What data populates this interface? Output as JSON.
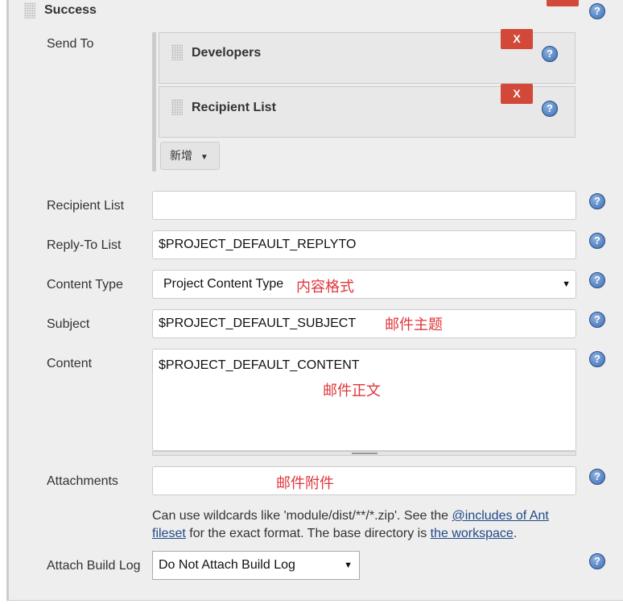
{
  "section": {
    "title": "Success"
  },
  "send_to": {
    "label": "Send To",
    "items": [
      {
        "label": "Developers"
      },
      {
        "label": "Recipient List"
      }
    ],
    "remove_label": "X",
    "add_label": "新增"
  },
  "fields": {
    "recipient_list": {
      "label": "Recipient List",
      "value": ""
    },
    "reply_to": {
      "label": "Reply-To List",
      "value": "$PROJECT_DEFAULT_REPLYTO"
    },
    "content_type": {
      "label": "Content Type",
      "value": "Project Content Type"
    },
    "subject": {
      "label": "Subject",
      "value": "$PROJECT_DEFAULT_SUBJECT"
    },
    "content": {
      "label": "Content",
      "value": "$PROJECT_DEFAULT_CONTENT"
    },
    "attachments": {
      "label": "Attachments",
      "value": ""
    },
    "attach_build_log": {
      "label": "Attach Build Log",
      "value": "Do Not Attach Build Log"
    }
  },
  "attachments_help": {
    "t1": "Can use wildcards like 'module/dist/**/*.zip'. See the ",
    "link1": "@includes of Ant fileset",
    "t2": " for the exact format. The base directory is ",
    "link2": "the workspace",
    "t3": "."
  },
  "annotations": {
    "content_type": "内容格式",
    "subject": "邮件主题",
    "content": "邮件正文",
    "attachments": "邮件附件"
  },
  "colors": {
    "remove": "#d24939",
    "annotation": "#e0353a",
    "link": "#204a87"
  }
}
